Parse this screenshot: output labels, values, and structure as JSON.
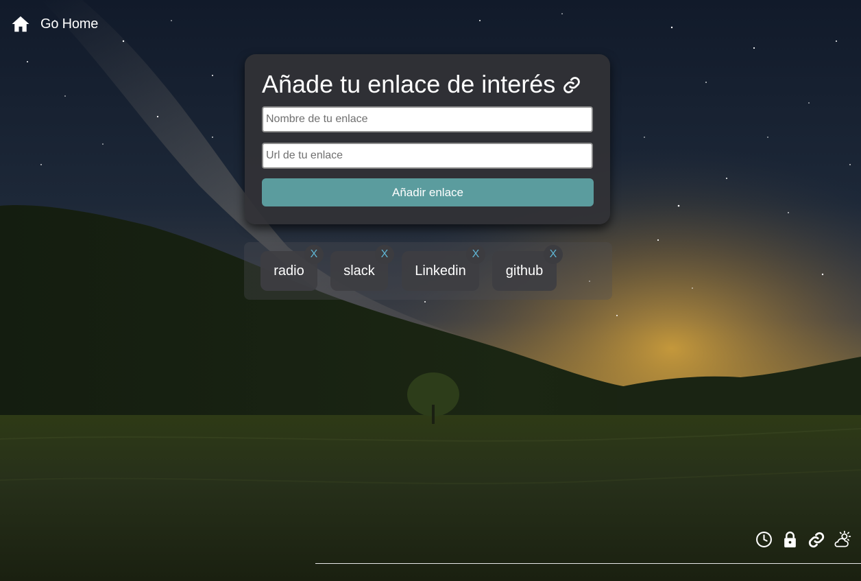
{
  "nav": {
    "home_label": "Go Home",
    "home_icon": "home-icon"
  },
  "form": {
    "title": "Añade tu enlace de interés",
    "title_icon": "link-icon",
    "name_placeholder": "Nombre de tu enlace",
    "name_value": "",
    "url_placeholder": "Url de tu enlace",
    "url_value": "",
    "submit_label": "Añadir enlace"
  },
  "links": {
    "items": [
      {
        "label": "radio",
        "remove_label": "X"
      },
      {
        "label": "slack",
        "remove_label": "X"
      },
      {
        "label": "Linkedin",
        "remove_label": "X"
      },
      {
        "label": "github",
        "remove_label": "X"
      }
    ]
  },
  "bottom_nav": {
    "icons": [
      "clock-icon",
      "lock-icon",
      "link-icon",
      "weather-icon"
    ]
  },
  "colors": {
    "accent_button": "#5b9c9e",
    "remove_x": "#5fb5d4",
    "card_bg": "#323236",
    "text": "#ffffff"
  }
}
